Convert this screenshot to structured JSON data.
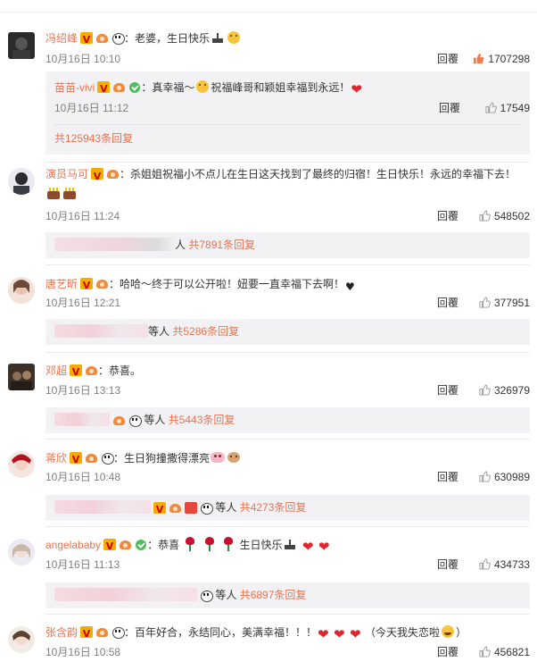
{
  "comments": [
    {
      "name": "冯绍峰",
      "text": "：老婆，生日快乐",
      "time": "10月16日 10:10",
      "reply_label": "回覆",
      "likes": "1707298",
      "likes_highlight": true,
      "nested_reply": {
        "name": "苗苗-vivi",
        "text_a": "：真幸福～",
        "text_b": "祝福峰哥和颖姐幸福到永远！",
        "time": "10月16日 11:12",
        "reply_label": "回覆",
        "likes": "17549"
      },
      "more_replies": "共125943条回复"
    },
    {
      "name": "演员马可",
      "text": "：杀姐姐祝福小不点儿在生日这天找到了最终的归宿！生日快乐！永远的幸福下去！",
      "time": "10月16日 11:24",
      "reply_label": "回覆",
      "likes": "548502",
      "sub_suffix": "人",
      "sub_count": "共7891条回复"
    },
    {
      "name": "唐艺昕",
      "text": "：哈哈～终于可以公开啦！妞要一直幸福下去啊！",
      "time": "10月16日 12:21",
      "reply_label": "回覆",
      "likes": "377951",
      "sub_suffix": "等人",
      "sub_count": "共5286条回复"
    },
    {
      "name": "邓超",
      "text": "：恭喜。",
      "time": "10月16日 13:13",
      "reply_label": "回覆",
      "likes": "326979",
      "sub_suffix": "等人",
      "sub_count": "共5443条回复"
    },
    {
      "name": "蒋欣",
      "text": "：生日狗撞撒得漂亮",
      "time": "10月16日 10:48",
      "reply_label": "回覆",
      "likes": "630989",
      "sub_suffix": "等人",
      "sub_count": "共4273条回复"
    },
    {
      "name": "angelababy",
      "text_a": "：恭喜",
      "text_b": "生日快乐",
      "time": "10月16日 11:13",
      "reply_label": "回覆",
      "likes": "434733",
      "sub_suffix": "等人",
      "sub_count": "共6897条回复"
    },
    {
      "name": "张含韵",
      "text_a": "：百年好合，永结同心，美满幸福！！！",
      "text_b": "（今天我失恋啦",
      "text_c": "）",
      "time": "10月16日 10:58",
      "reply_label": "回覆",
      "likes": "456821"
    }
  ],
  "colors": {
    "username": "#eb7350",
    "reply_box": "#f2f2f5",
    "meta": "#808080",
    "like_highlight": "#eb7350"
  },
  "icons": [
    "thumb-up-icon",
    "vip-badge-icon",
    "crown-badge-icon",
    "panda-badge-icon",
    "heart-icon"
  ]
}
